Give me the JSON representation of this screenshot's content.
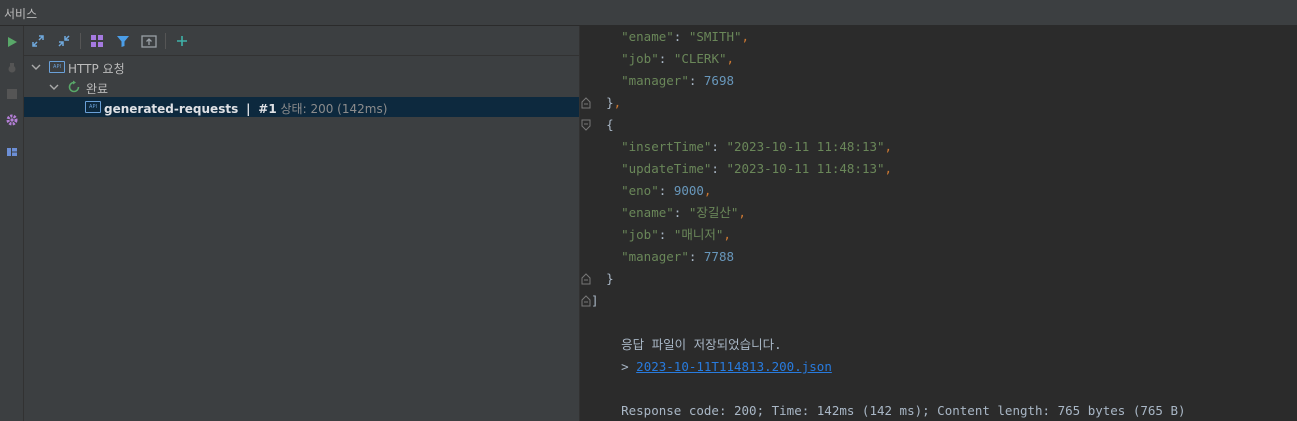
{
  "window": {
    "title": "서비스"
  },
  "tree": {
    "root_label": "HTTP 요청",
    "group_label": "완료",
    "request": {
      "name": "generated-requests",
      "sep": "|",
      "num": "#1",
      "status": "상태: 200 (142ms)"
    }
  },
  "editor": {
    "lines": [
      {
        "indent": "    ",
        "key": "\"ename\"",
        "colon": ": ",
        "value": "\"SMITH\"",
        "vtype": "str",
        "comma": ","
      },
      {
        "indent": "    ",
        "key": "\"job\"",
        "colon": ": ",
        "value": "\"CLERK\"",
        "vtype": "str",
        "comma": ","
      },
      {
        "indent": "    ",
        "key": "\"manager\"",
        "colon": ": ",
        "value": "7698",
        "vtype": "num",
        "comma": ""
      },
      {
        "indent": "  ",
        "text": "}",
        "comma": ",",
        "fold": "end"
      },
      {
        "indent": "  ",
        "text": "{",
        "comma": "",
        "fold": "start"
      },
      {
        "indent": "    ",
        "key": "\"insertTime\"",
        "colon": ": ",
        "value": "\"2023-10-11 11:48:13\"",
        "vtype": "str",
        "comma": ","
      },
      {
        "indent": "    ",
        "key": "\"updateTime\"",
        "colon": ": ",
        "value": "\"2023-10-11 11:48:13\"",
        "vtype": "str",
        "comma": ","
      },
      {
        "indent": "    ",
        "key": "\"eno\"",
        "colon": ": ",
        "value": "9000",
        "vtype": "num",
        "comma": ","
      },
      {
        "indent": "    ",
        "key": "\"ename\"",
        "colon": ": ",
        "value": "\"장길산\"",
        "vtype": "str",
        "comma": ","
      },
      {
        "indent": "    ",
        "key": "\"job\"",
        "colon": ": ",
        "value": "\"매니저\"",
        "vtype": "str",
        "comma": ","
      },
      {
        "indent": "    ",
        "key": "\"manager\"",
        "colon": ": ",
        "value": "7788",
        "vtype": "num",
        "comma": ""
      },
      {
        "indent": "  ",
        "text": "}",
        "comma": "",
        "fold": "end"
      },
      {
        "indent": "",
        "text": "]",
        "comma": "",
        "fold": "end"
      }
    ],
    "saved_message": "응답 파일이 저장되었습니다.",
    "file_prefix": "> ",
    "file_link": "2023-10-11T114813.200.json",
    "response_summary": "Response code: 200; Time: 142ms (142 ms); Content length: 765 bytes (765 B)"
  },
  "colors": {
    "string": "#6a8759",
    "number": "#6897bb",
    "punctuation": "#cc7832",
    "link": "#287bde",
    "selection": "#0d293e"
  },
  "icons": [
    "run-icon",
    "debug-icon",
    "stop-icon",
    "settings-icon",
    "layout-icon",
    "expand-all-icon",
    "collapse-all-icon",
    "group-by-icon",
    "filter-icon",
    "new-tab-icon",
    "add-icon",
    "chevron-down-icon",
    "refresh-icon",
    "api-icon",
    "fold-icon"
  ]
}
